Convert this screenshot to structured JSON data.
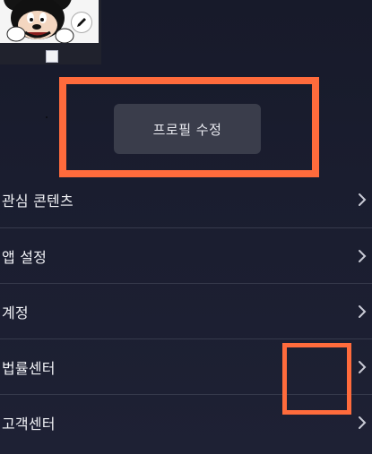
{
  "profile": {
    "edit_button_label": "프로필 수정"
  },
  "menu": {
    "items": [
      {
        "label": "관심 콘텐츠",
        "icon": "chevron-right-icon"
      },
      {
        "label": "앱 설정",
        "icon": "chevron-right-icon"
      },
      {
        "label": "계정",
        "icon": "chevron-right-icon"
      },
      {
        "label": "법률센터",
        "icon": "chevron-right-icon"
      },
      {
        "label": "고객센터",
        "icon": "chevron-right-icon"
      }
    ]
  },
  "colors": {
    "background": "#1a1d2f",
    "button": "#3a3d4b",
    "highlight": "#ff6b3c",
    "divider": "#363a4c"
  }
}
